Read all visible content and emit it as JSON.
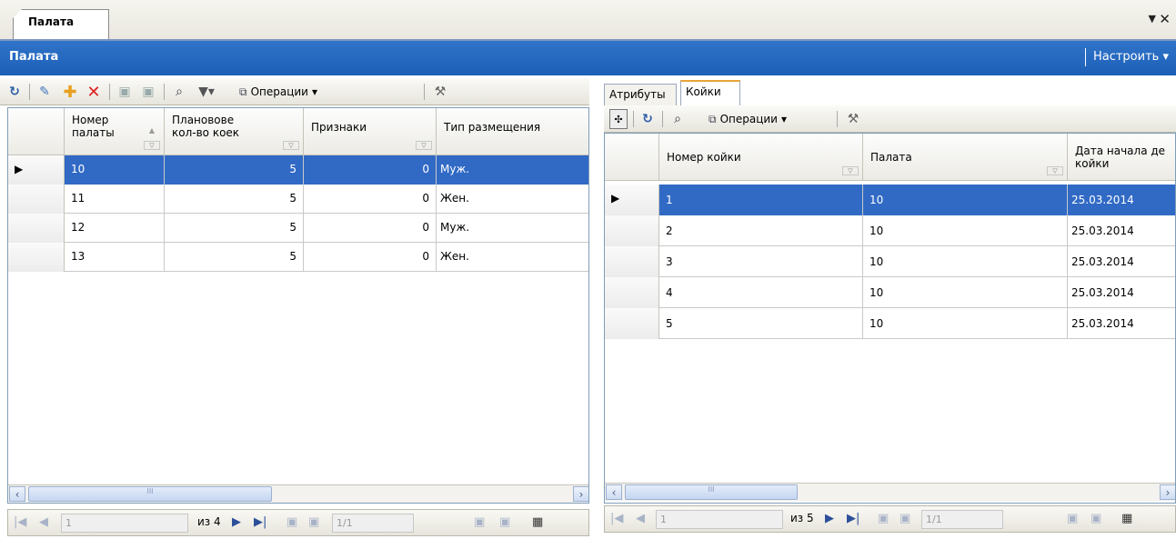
{
  "document_tab": {
    "label": "Палата"
  },
  "header": {
    "title": "Палата",
    "customize": "Настроить"
  },
  "left": {
    "toolbar": {
      "operations": "Операции"
    },
    "columns": [
      {
        "line1": "Номер",
        "line2": "палаты"
      },
      {
        "line1": "Плановове",
        "line2": "кол-во коек"
      },
      {
        "line1": "Признаки",
        "line2": ""
      },
      {
        "line1": "Тип размещения",
        "line2": ""
      }
    ],
    "rows": [
      {
        "number": "10",
        "beds": "5",
        "signs": "0",
        "type": "Муж.",
        "selected": true
      },
      {
        "number": "11",
        "beds": "5",
        "signs": "0",
        "type": "Жен.",
        "selected": false
      },
      {
        "number": "12",
        "beds": "5",
        "signs": "0",
        "type": "Муж.",
        "selected": false
      },
      {
        "number": "13",
        "beds": "5",
        "signs": "0",
        "type": "Жен.",
        "selected": false
      }
    ],
    "pager": {
      "page_input": "1",
      "of": "из 4",
      "range": "1/1"
    }
  },
  "right": {
    "tabs": [
      "Атрибуты",
      "Койки"
    ],
    "active_tab": "Койки",
    "toolbar": {
      "operations": "Операции"
    },
    "columns": [
      {
        "line1": "Номер койки",
        "line2": ""
      },
      {
        "line1": "Палата",
        "line2": ""
      },
      {
        "line1": "Дата начала де",
        "line2": "койки"
      }
    ],
    "rows": [
      {
        "bed": "1",
        "ward": "10",
        "date": "25.03.2014",
        "selected": true
      },
      {
        "bed": "2",
        "ward": "10",
        "date": "25.03.2014",
        "selected": false
      },
      {
        "bed": "3",
        "ward": "10",
        "date": "25.03.2014",
        "selected": false
      },
      {
        "bed": "4",
        "ward": "10",
        "date": "25.03.2014",
        "selected": false
      },
      {
        "bed": "5",
        "ward": "10",
        "date": "25.03.2014",
        "selected": false
      }
    ],
    "pager": {
      "page_input": "1",
      "of": "из 5",
      "range": "1/1"
    }
  },
  "colors": {
    "header": "#2069c2",
    "selection": "#316ac5",
    "tab_accent": "#e8a33a"
  }
}
